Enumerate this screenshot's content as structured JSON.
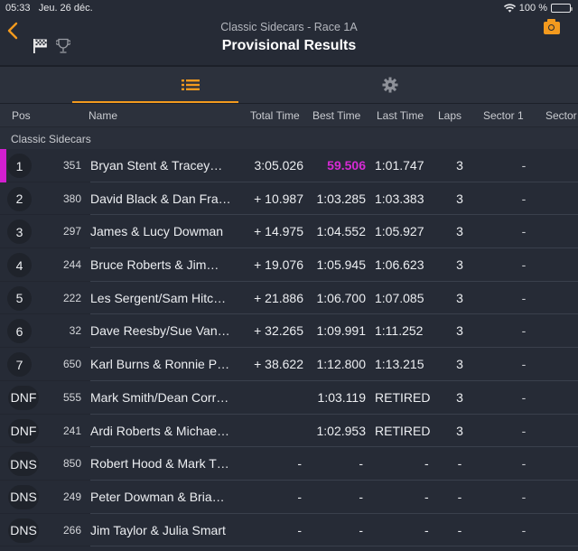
{
  "status_bar": {
    "time": "05:33",
    "date": "Jeu. 26 déc.",
    "wifi_icon": "wifi-icon",
    "battery_percent": "100 %",
    "battery_level": 1.0
  },
  "header": {
    "subtitle": "Classic Sidecars - Race 1A",
    "title": "Provisional Results",
    "back_icon": "chevron-left-icon",
    "flag_icon": "checkered-flag-icon",
    "trophy_icon": "trophy-icon",
    "camera_icon": "camera-icon"
  },
  "colors": {
    "accent": "#f39a1e",
    "fastest_lap": "#d62ad4",
    "background": "#262b36"
  },
  "tabs": [
    {
      "name": "list",
      "icon": "list-icon",
      "active": true
    },
    {
      "name": "settings",
      "icon": "gear-icon",
      "active": false
    }
  ],
  "columns": {
    "pos": "Pos",
    "name": "Name",
    "total_time": "Total Time",
    "best_time": "Best Time",
    "last_time": "Last Time",
    "laps": "Laps",
    "sector1": "Sector 1",
    "sector2": "Sector"
  },
  "group": {
    "title": "Classic Sidecars"
  },
  "rows": [
    {
      "pos": "1",
      "num": "351",
      "name": "Bryan Stent & Tracey…",
      "total": "3:05.026",
      "best": "59.506",
      "last": "1:01.747",
      "laps": "3",
      "s1": "-",
      "leader": true,
      "fastest": true
    },
    {
      "pos": "2",
      "num": "380",
      "name": "David Black & Dan Fra…",
      "total": "+ 10.987",
      "best": "1:03.285",
      "last": "1:03.383",
      "laps": "3",
      "s1": "-"
    },
    {
      "pos": "3",
      "num": "297",
      "name": "James & Lucy Dowman",
      "total": "+ 14.975",
      "best": "1:04.552",
      "last": "1:05.927",
      "laps": "3",
      "s1": "-"
    },
    {
      "pos": "4",
      "num": "244",
      "name": "Bruce Roberts & Jim…",
      "total": "+ 19.076",
      "best": "1:05.945",
      "last": "1:06.623",
      "laps": "3",
      "s1": "-"
    },
    {
      "pos": "5",
      "num": "222",
      "name": "Les Sergent/Sam Hitc…",
      "total": "+ 21.886",
      "best": "1:06.700",
      "last": "1:07.085",
      "laps": "3",
      "s1": "-"
    },
    {
      "pos": "6",
      "num": "32",
      "name": "Dave Reesby/Sue Van…",
      "total": "+ 32.265",
      "best": "1:09.991",
      "last": "1:11.252",
      "laps": "3",
      "s1": "-"
    },
    {
      "pos": "7",
      "num": "650",
      "name": "Karl Burns & Ronnie P…",
      "total": "+ 38.622",
      "best": "1:12.800",
      "last": "1:13.215",
      "laps": "3",
      "s1": "-"
    },
    {
      "pos": "DNF",
      "num": "555",
      "name": "Mark Smith/Dean Corr…",
      "total": "",
      "best": "1:03.119",
      "last": "RETIRED",
      "laps": "3",
      "s1": "-"
    },
    {
      "pos": "DNF",
      "num": "241",
      "name": "Ardi Roberts & Michae…",
      "total": "",
      "best": "1:02.953",
      "last": "RETIRED",
      "laps": "3",
      "s1": "-"
    },
    {
      "pos": "DNS",
      "num": "850",
      "name": "Robert Hood & Mark T…",
      "total": "-",
      "best": "-",
      "last": "-",
      "laps": "-",
      "s1": "-"
    },
    {
      "pos": "DNS",
      "num": "249",
      "name": "Peter Dowman & Bria…",
      "total": "-",
      "best": "-",
      "last": "-",
      "laps": "-",
      "s1": "-"
    },
    {
      "pos": "DNS",
      "num": "266",
      "name": "Jim Taylor & Julia Smart",
      "total": "-",
      "best": "-",
      "last": "-",
      "laps": "-",
      "s1": "-"
    }
  ]
}
